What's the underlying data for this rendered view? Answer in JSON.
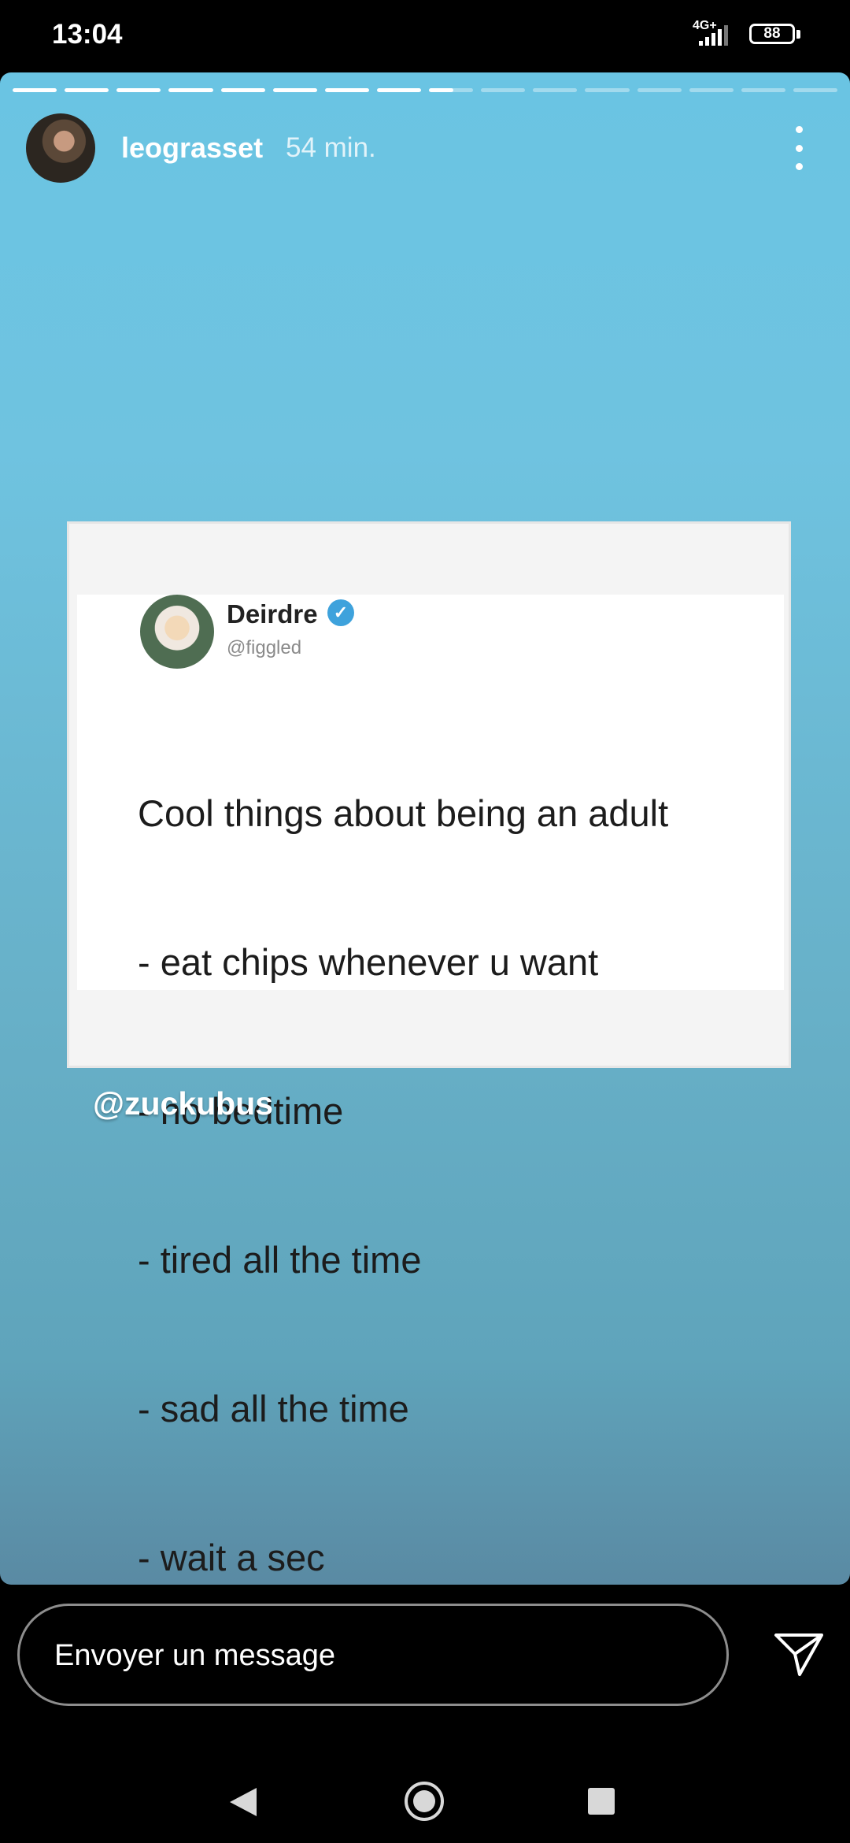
{
  "status_bar": {
    "time": "13:04",
    "network": "4G+",
    "battery": "88"
  },
  "story": {
    "progress": {
      "segments": 16,
      "completed": 8,
      "current_fill": 0.55
    },
    "user": {
      "username": "leograsset",
      "time_ago": "54 min."
    },
    "tweet": {
      "author_name": "Deirdre",
      "author_handle": "@figgled",
      "verified": true,
      "lines": [
        "Cool things about being an adult",
        "- eat chips whenever u want",
        "- no bedtime",
        "- tired all the time",
        "- sad all the time",
        "- wait a sec"
      ]
    },
    "mention": "@zuckubus"
  },
  "reply": {
    "placeholder": "Envoyer un message"
  },
  "icons": {
    "menu": "more-vertical-icon",
    "send": "send-icon",
    "verified": "verified-badge-icon",
    "nav_back": "back-icon",
    "nav_home": "home-icon",
    "nav_recent": "recent-apps-icon"
  }
}
